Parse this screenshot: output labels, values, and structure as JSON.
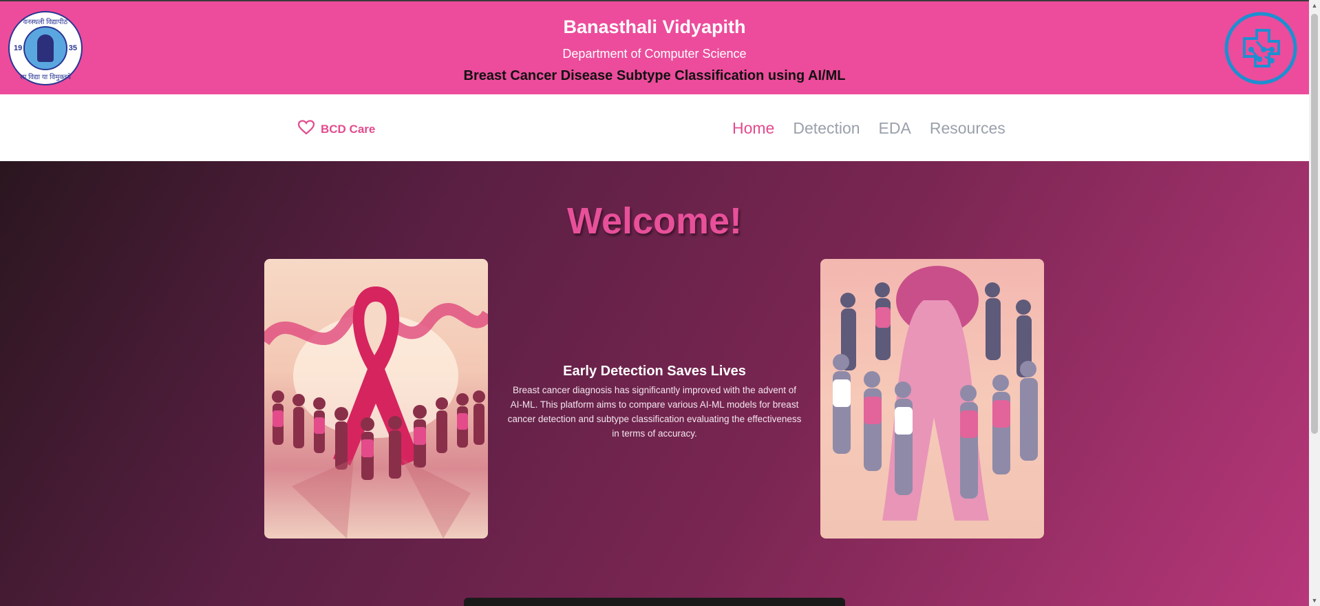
{
  "banner": {
    "university": "Banasthali Vidyapith",
    "department": "Department of Computer Science",
    "project": "Breast Cancer Disease Subtype Classification using AI/ML",
    "logo_left": {
      "top_text": "वनस्थली विद्यापीठ",
      "bottom_text": "सा विद्या या विमुक्तये",
      "year_left": "19",
      "year_right": "35"
    },
    "logo_right_icon": "circuit-icon"
  },
  "nav": {
    "brand_icon": "heart-icon",
    "brand": "BCD Care",
    "links": [
      {
        "label": "Home",
        "active": true
      },
      {
        "label": "Detection",
        "active": false
      },
      {
        "label": "EDA",
        "active": false
      },
      {
        "label": "Resources",
        "active": false
      }
    ]
  },
  "hero": {
    "heading": "Welcome!",
    "feature_title": "Early Detection Saves Lives",
    "feature_text": "Breast cancer diagnosis has significantly improved with the advent of AI-ML. This platform aims to compare various AI-ML models for breast cancer detection and subtype classification evaluating the effectiveness in terms of accuracy."
  },
  "colors": {
    "banner": "#ec4c9b",
    "accent": "#e24b8e",
    "nav_inactive": "#9aa0ab",
    "logo_right": "#1d8fd1"
  }
}
